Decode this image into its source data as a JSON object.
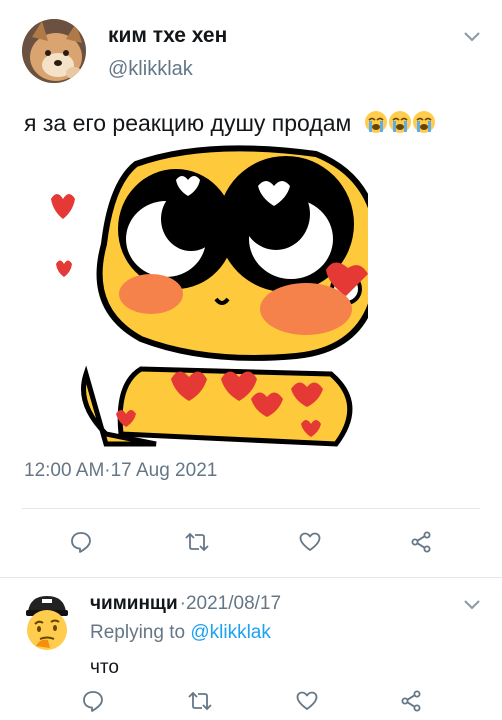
{
  "tweet": {
    "display_name": "ким тхе хен",
    "handle": "@klikklak",
    "text": "я за его реакцию душу продам",
    "emojis": [
      "loudly-crying-face",
      "loudly-crying-face",
      "loudly-crying-face"
    ],
    "timestamp": "12:00 AM·17 Aug 2021",
    "menu_icon": "chevron-down-icon",
    "media_icon": "cute-smiling-chick-with-hearts"
  },
  "actions": [
    "reply-icon",
    "retweet-icon",
    "like-icon",
    "share-icon"
  ],
  "reply": {
    "display_name": "чиминщи",
    "date": "·2021/08/17",
    "replying_prefix": "Replying to ",
    "replying_handle": "@klikklak",
    "text": "что",
    "avatar_icon": "thinking-face-with-cap"
  },
  "colors": {
    "secondary_text": "#657786",
    "link": "#1da1f2",
    "divider": "#e1e8ed",
    "icon": "#657786"
  }
}
